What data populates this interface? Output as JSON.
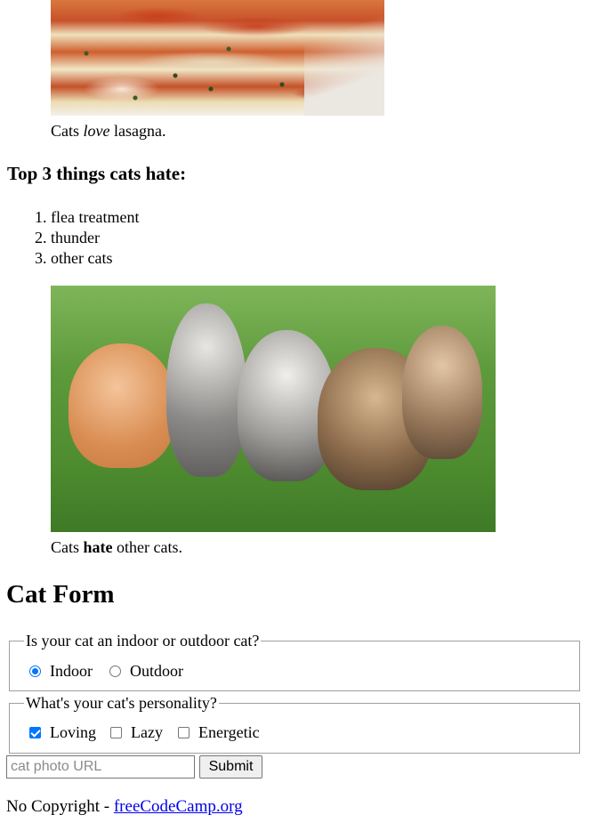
{
  "figure_lasagna": {
    "image_icon": "lasagna-photo",
    "caption_pre": "Cats ",
    "caption_em": "love",
    "caption_post": " lasagna."
  },
  "hate_section": {
    "heading": "Top 3 things cats hate:",
    "items": [
      "flea treatment",
      "thunder",
      "other cats"
    ]
  },
  "figure_kittens": {
    "image_icon": "kittens-photo",
    "caption_pre": "Cats ",
    "caption_strong": "hate",
    "caption_post": " other cats."
  },
  "form": {
    "title": "Cat Form",
    "location_fieldset": {
      "legend": "Is your cat an indoor or outdoor cat?",
      "options": [
        {
          "label": "Indoor",
          "checked": true
        },
        {
          "label": "Outdoor",
          "checked": false
        }
      ]
    },
    "personality_fieldset": {
      "legend": "What's your cat's personality?",
      "options": [
        {
          "label": "Loving",
          "checked": true
        },
        {
          "label": "Lazy",
          "checked": false
        },
        {
          "label": "Energetic",
          "checked": false
        }
      ]
    },
    "url_placeholder": "cat photo URL",
    "submit_label": "Submit"
  },
  "footer": {
    "text": "No Copyright - ",
    "link_text": "freeCodeCamp.org"
  },
  "colors": {
    "link": "#0000ee",
    "control_accent": "#0075ff"
  }
}
